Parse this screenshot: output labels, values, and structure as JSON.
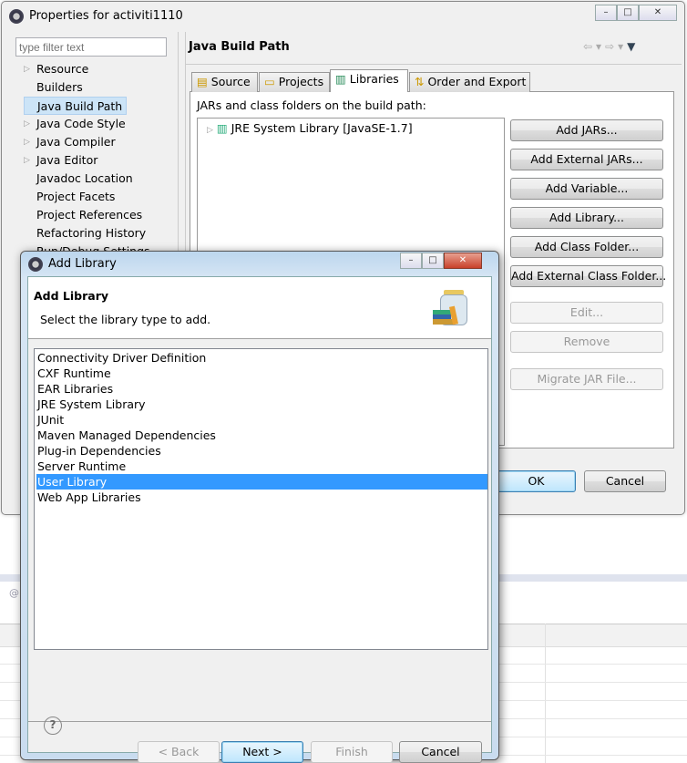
{
  "properties_window": {
    "title": "Properties for activiti1110",
    "filter_placeholder": "type filter text",
    "nav_items": [
      {
        "label": "Resource",
        "expandable": true
      },
      {
        "label": "Builders",
        "expandable": false
      },
      {
        "label": "Java Build Path",
        "expandable": false,
        "selected": true
      },
      {
        "label": "Java Code Style",
        "expandable": true
      },
      {
        "label": "Java Compiler",
        "expandable": true
      },
      {
        "label": "Java Editor",
        "expandable": true
      },
      {
        "label": "Javadoc Location",
        "expandable": false
      },
      {
        "label": "Project Facets",
        "expandable": false
      },
      {
        "label": "Project References",
        "expandable": false
      },
      {
        "label": "Refactoring History",
        "expandable": false
      },
      {
        "label": "Run/Debug Settings",
        "expandable": false
      }
    ],
    "page_title": "Java Build Path",
    "tabs": [
      {
        "label": "Source"
      },
      {
        "label": "Projects"
      },
      {
        "label": "Libraries",
        "active": true
      },
      {
        "label": "Order and Export"
      }
    ],
    "build_path_label": "JARs and class folders on the build path:",
    "tree_items": [
      {
        "label": "JRE System Library [JavaSE-1.7]"
      }
    ],
    "side_buttons": [
      {
        "label": "Add JARs...",
        "enabled": true
      },
      {
        "label": "Add External JARs...",
        "enabled": true
      },
      {
        "label": "Add Variable...",
        "enabled": true
      },
      {
        "label": "Add Library...",
        "enabled": true
      },
      {
        "label": "Add Class Folder...",
        "enabled": true
      },
      {
        "label": "Add External Class Folder...",
        "enabled": true
      },
      {
        "label": "Edit...",
        "enabled": false
      },
      {
        "label": "Remove",
        "enabled": false
      },
      {
        "label": "Migrate JAR File...",
        "enabled": false
      }
    ],
    "ok_label": "OK",
    "cancel_label": "Cancel"
  },
  "add_library_dialog": {
    "title": "Add Library",
    "header_title": "Add Library",
    "header_description": "Select the library type to add.",
    "library_types": [
      "Connectivity Driver Definition",
      "CXF Runtime",
      "EAR Libraries",
      "JRE System Library",
      "JUnit",
      "Maven Managed Dependencies",
      "Plug-in Dependencies",
      "Server Runtime",
      "User Library",
      "Web App Libraries"
    ],
    "selected_type": "User Library",
    "back_label": "< Back",
    "next_label": "Next >",
    "finish_label": "Finish",
    "cancel_label": "Cancel",
    "selection_color": "#3399ff"
  }
}
